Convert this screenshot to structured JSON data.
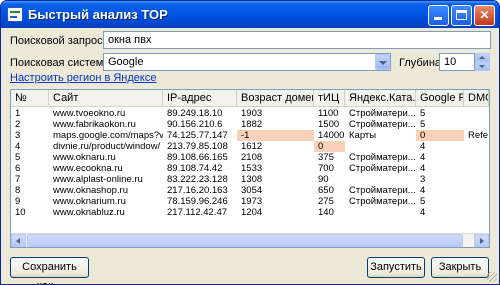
{
  "window": {
    "title": "Быстрый анализ TOP"
  },
  "form": {
    "query_label": "Поисковой запрос:",
    "query_value": "окна пвх",
    "engine_label": "Поисковая система:",
    "engine_value": "Google",
    "depth_label": "Глубина:",
    "depth_value": "10",
    "region_link": "Настроить регион в Яндексе"
  },
  "table": {
    "columns": [
      "№",
      "Сайт",
      "IP-адрес",
      "Возраст домена...",
      "тИЦ",
      "Яндекс.Ката...",
      "Google PR",
      "DMOZ"
    ],
    "rows": [
      {
        "n": "1",
        "site": "www.tvoeokno.ru",
        "ip": "89.249.18.10",
        "age": "1903",
        "tic": "1100",
        "yaca": "Стройматери...",
        "pr": "5",
        "dmoz": ""
      },
      {
        "n": "2",
        "site": "www.fabrikaokon.ru",
        "ip": "90.156.210.6",
        "age": "1882",
        "tic": "1500",
        "yaca": "Стройматери...",
        "pr": "5",
        "dmoz": ""
      },
      {
        "n": "3",
        "site": "maps.google.com/maps?vi...",
        "ip": "74.125.77.147",
        "age": "-1",
        "tic": "14000",
        "yaca": "Карты",
        "pr": "0",
        "dmoz": "Refe..."
      },
      {
        "n": "4",
        "site": "divnie.ru/product/window/",
        "ip": "213.79.85.108",
        "age": "1612",
        "tic": "0",
        "yaca": "",
        "pr": "4",
        "dmoz": ""
      },
      {
        "n": "5",
        "site": "www.oknaru.ru",
        "ip": "89.108.66.165",
        "age": "2108",
        "tic": "375",
        "yaca": "Стройматери...",
        "pr": "4",
        "dmoz": ""
      },
      {
        "n": "6",
        "site": "www.ecookna.ru",
        "ip": "89.108.74.42",
        "age": "1533",
        "tic": "700",
        "yaca": "Стройматери...",
        "pr": "4",
        "dmoz": ""
      },
      {
        "n": "7",
        "site": "www.alplast-online.ru",
        "ip": "83.222.23.128",
        "age": "1308",
        "tic": "90",
        "yaca": "",
        "pr": "3",
        "dmoz": ""
      },
      {
        "n": "8",
        "site": "www.oknashop.ru",
        "ip": "217.16.20.163",
        "age": "3054",
        "tic": "650",
        "yaca": "Стройматери...",
        "pr": "4",
        "dmoz": ""
      },
      {
        "n": "9",
        "site": "www.oknarium.ru",
        "ip": "78.159.96.246",
        "age": "1973",
        "tic": "275",
        "yaca": "Стройматери...",
        "pr": "5",
        "dmoz": ""
      },
      {
        "n": "10",
        "site": "www.oknabluz.ru",
        "ip": "217.112.42.47",
        "age": "1204",
        "tic": "140",
        "yaca": "",
        "pr": "4",
        "dmoz": ""
      }
    ],
    "highlight": {
      "row": 2,
      "cells": [
        "age",
        "pr"
      ]
    },
    "highlight_row4": {
      "row": 3,
      "cells": [
        "tic"
      ]
    }
  },
  "buttons": {
    "save": "Сохранить как...",
    "run": "Запустить",
    "close": "Закрыть"
  },
  "colors": {
    "highlight": "#fbd0b8",
    "link": "#0033cc",
    "titlebar": "#0055e5"
  }
}
